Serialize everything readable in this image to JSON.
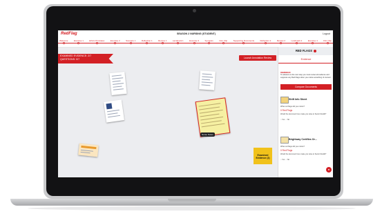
{
  "app": {
    "logo": "RedFlag",
    "title": "SEASON 2 NURSING (STUDENT)",
    "logout": "Logout"
  },
  "nav": {
    "items": [
      "Welcome",
      "Exercise 1",
      "Ethics Principles",
      "Exercise 2",
      "Scenario 1",
      "Reflection 1",
      "Review 1",
      "Landmark 1",
      "Exercise 3",
      "Synopsis",
      "Intro Clip",
      "Supporting Documents",
      "Reflection 2",
      "Review 2",
      "Landmark 2",
      "Exercise 4",
      "Film Clip"
    ]
  },
  "banner": {
    "line1": "EXAMINED EVIDENCE: 2/7",
    "line2": "QUESTIONS: 0/7"
  },
  "launch_button": "Launch Annotation Review",
  "tag_label": "Nurse Notes",
  "examined_badge": "Examined Evidence (2)",
  "panel": {
    "header": "RED FLAGS",
    "tab": "Evidence",
    "reminder_title": "REMINDER!",
    "reminder_text": "To advance to the next step you must review all evidence and suppress any Red Flags when you notice something of concern.",
    "compare_button": "Compare Documents",
    "cards": [
      {
        "title": "Shift Info Sheet",
        "question": "What red flags did you notice?",
        "value": "0 Red Flags",
        "question2": "Would the document here make you raise to Senior Reddit?",
        "yes": "Yes",
        "no": "No"
      },
      {
        "title": "Brightway Certifies Or...",
        "question": "What red flags did you notice?",
        "value": "0 Red Flags",
        "question2": "Would the document here make you raise to Senior Reddit?",
        "yes": "Yes",
        "no": "No"
      }
    ]
  },
  "colors": {
    "accent": "#d32025",
    "badge": "#f1c21b"
  }
}
